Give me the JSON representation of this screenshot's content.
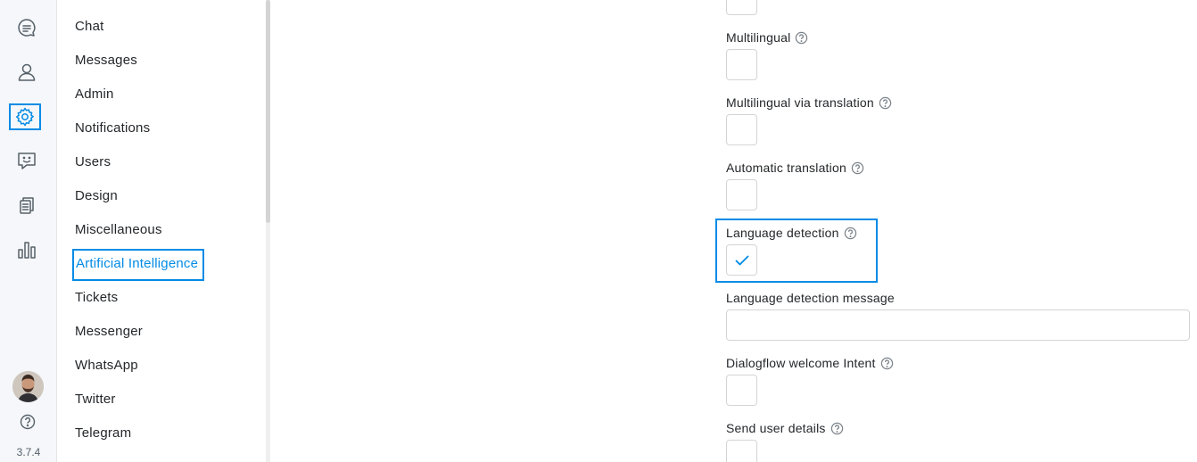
{
  "rail": {
    "icons": [
      "chat-bubble-icon",
      "user-icon",
      "gear-icon",
      "smile-message-icon",
      "documents-icon",
      "bar-chart-icon"
    ],
    "active": "gear-icon",
    "version": "3.7.4"
  },
  "nav": {
    "items": [
      {
        "label": "Chat"
      },
      {
        "label": "Messages"
      },
      {
        "label": "Admin"
      },
      {
        "label": "Notifications"
      },
      {
        "label": "Users"
      },
      {
        "label": "Design"
      },
      {
        "label": "Miscellaneous"
      },
      {
        "label": "Artificial Intelligence",
        "active": true
      },
      {
        "label": "Tickets"
      },
      {
        "label": "Messenger"
      },
      {
        "label": "WhatsApp"
      },
      {
        "label": "Twitter"
      },
      {
        "label": "Telegram"
      }
    ]
  },
  "settings": {
    "multilingual": {
      "label": "Multilingual",
      "checked": false
    },
    "multilingual_translation": {
      "label": "Multilingual via translation",
      "checked": false
    },
    "automatic_translation": {
      "label": "Automatic translation",
      "checked": false
    },
    "language_detection": {
      "label": "Language detection",
      "checked": true
    },
    "language_detection_message": {
      "label": "Language detection message",
      "value": ""
    },
    "dialogflow_welcome": {
      "label": "Dialogflow welcome Intent",
      "checked": false
    },
    "send_user_details": {
      "label": "Send user details",
      "checked": false
    }
  },
  "colors": {
    "accent": "#028be5",
    "text": "#24272a",
    "border": "#d4d4d4"
  }
}
